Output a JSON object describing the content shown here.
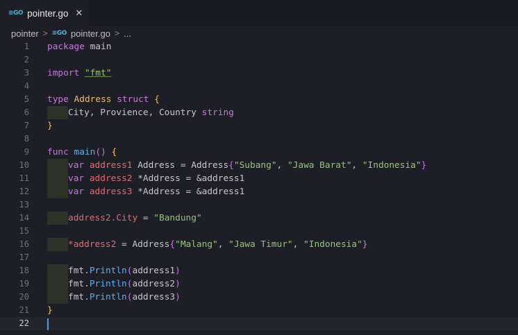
{
  "tab": {
    "icon": "go-file-icon",
    "label": "pointer.go",
    "close": "✕"
  },
  "breadcrumb": {
    "folder": "pointer",
    "file": "pointer.go",
    "more": "..."
  },
  "lines": [
    {
      "n": "1"
    },
    {
      "n": "2"
    },
    {
      "n": "3"
    },
    {
      "n": "4"
    },
    {
      "n": "5"
    },
    {
      "n": "6"
    },
    {
      "n": "7"
    },
    {
      "n": "8"
    },
    {
      "n": "9"
    },
    {
      "n": "10"
    },
    {
      "n": "11"
    },
    {
      "n": "12"
    },
    {
      "n": "13"
    },
    {
      "n": "14"
    },
    {
      "n": "15"
    },
    {
      "n": "16"
    },
    {
      "n": "17"
    },
    {
      "n": "18"
    },
    {
      "n": "19"
    },
    {
      "n": "20"
    },
    {
      "n": "21"
    },
    {
      "n": "22"
    }
  ],
  "code": {
    "l1": [
      "package",
      " main"
    ],
    "l3": [
      "import",
      " ",
      "\"fmt\""
    ],
    "l5": [
      "type",
      " ",
      "Address",
      " ",
      "struct",
      " ",
      "{"
    ],
    "l6": [
      "City, Provience, Country",
      " ",
      "string"
    ],
    "l7": [
      "}"
    ],
    "l9": [
      "func",
      " ",
      "main",
      "()",
      " ",
      "{"
    ],
    "l10": [
      "var",
      " ",
      "address1",
      " Address = Address",
      "{",
      "\"Subang\"",
      ", ",
      "\"Jawa Barat\"",
      ", ",
      "\"Indonesia\"",
      "}"
    ],
    "l11": [
      "var",
      " ",
      "address2",
      " *Address = &address1"
    ],
    "l12": [
      "var",
      " ",
      "address3",
      " *Address = &address1"
    ],
    "l14": [
      "address2",
      ".City",
      " = ",
      "\"Bandung\""
    ],
    "l16": [
      "*address2",
      " = Address",
      "{",
      "\"Malang\"",
      ", ",
      "\"Jawa Timur\"",
      ", ",
      "\"Indonesia\"",
      "}"
    ],
    "l18": [
      "fmt.",
      "Println",
      "(",
      "address1",
      ")"
    ],
    "l19": [
      "fmt.",
      "Println",
      "(",
      "address2",
      ")"
    ],
    "l20": [
      "fmt.",
      "Println",
      "(",
      "address3",
      ")"
    ],
    "l21": [
      "}"
    ]
  }
}
